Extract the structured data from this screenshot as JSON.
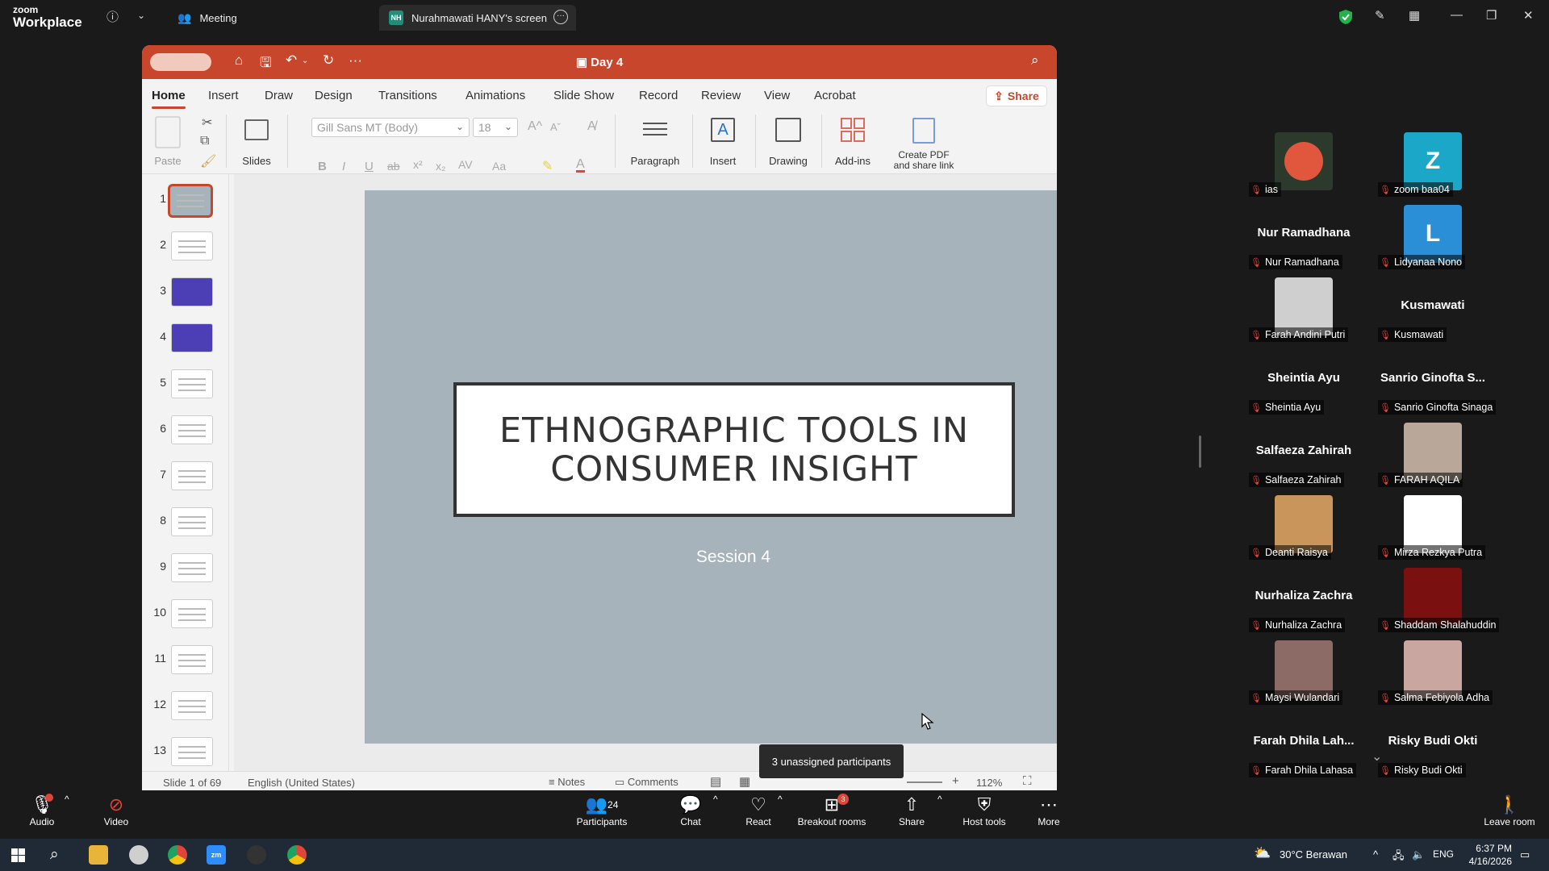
{
  "zoom": {
    "logo_line1": "zoom",
    "logo_line2": "Workplace",
    "meeting_tab": "Meeting",
    "screen_tab": "Nurahmawati HANY's screen",
    "screen_tab_initials": "NH"
  },
  "ppt": {
    "doc_title": "Day 4",
    "tabs": [
      "Home",
      "Insert",
      "Draw",
      "Design",
      "Transitions",
      "Animations",
      "Slide Show",
      "Record",
      "Review",
      "View",
      "Acrobat"
    ],
    "share_label": "Share",
    "ribbon": {
      "paste": "Paste",
      "slides": "Slides",
      "font_name": "Gill Sans MT (Body)",
      "font_size": "18",
      "paragraph": "Paragraph",
      "insert": "Insert",
      "drawing": "Drawing",
      "addins": "Add-ins",
      "create_pdf_1": "Create PDF",
      "create_pdf_2": "and share link"
    },
    "slide_numbers": [
      "1",
      "2",
      "3",
      "4",
      "5",
      "6",
      "7",
      "8",
      "9",
      "10",
      "11",
      "12",
      "13"
    ],
    "slide": {
      "title_line1": "ETHNOGRAPHIC TOOLS IN",
      "title_line2": "CONSUMER INSIGHT",
      "subtitle": "Session 4"
    },
    "status": {
      "slide_of": "Slide 1 of 69",
      "language": "English (United States)",
      "notes": "Notes",
      "comments": "Comments",
      "zoom": "112%"
    }
  },
  "tooltip": "3 unassigned participants",
  "gallery": [
    {
      "name": "",
      "label": "ias",
      "avatar": "crab"
    },
    {
      "name": "",
      "label": "zoom baa04",
      "avatar": "letter",
      "letter": "Z",
      "color": "#1ba7c8"
    },
    {
      "name": "Nur Ramadhana",
      "label": "Nur Ramadhana"
    },
    {
      "name": "",
      "label": "Lidyanaa Nono",
      "avatar": "letter",
      "letter": "L",
      "color": "#2a8fd6"
    },
    {
      "name": "",
      "label": "Farah Andini Putri",
      "avatar": "photo",
      "color": "#cfcfcf"
    },
    {
      "name": "Kusmawati",
      "label": "Kusmawati"
    },
    {
      "name": "Sheintia Ayu",
      "label": "Sheintia Ayu"
    },
    {
      "name": "Sanrio Ginofta S...",
      "label": "Sanrio Ginofta Sinaga"
    },
    {
      "name": "Salfaeza Zahirah",
      "label": "Salfaeza Zahirah"
    },
    {
      "name": "",
      "label": "FARAH AQILA",
      "avatar": "photo",
      "color": "#b9a89a"
    },
    {
      "name": "",
      "label": "Deanti Raisya",
      "avatar": "photo",
      "color": "#c9955a"
    },
    {
      "name": "",
      "label": "Mirza Rezkya Putra",
      "avatar": "photo",
      "color": "#ffffff"
    },
    {
      "name": "Nurhaliza Zachra",
      "label": "Nurhaliza Zachra"
    },
    {
      "name": "",
      "label": "Shaddam Shalahuddin",
      "avatar": "photo",
      "color": "#7a1010"
    },
    {
      "name": "",
      "label": "Maysi Wulandari",
      "avatar": "photo",
      "color": "#8c6b66"
    },
    {
      "name": "",
      "label": "Salma Febiyola Adha",
      "avatar": "photo",
      "color": "#c9a7a0"
    },
    {
      "name": "Farah Dhila Lah...",
      "label": "Farah Dhila Lahasa"
    },
    {
      "name": "Risky Budi Okti",
      "label": "Risky Budi Okti"
    }
  ],
  "toolbar": {
    "audio": "Audio",
    "video": "Video",
    "participants": "Participants",
    "participants_count": "24",
    "chat": "Chat",
    "react": "React",
    "breakout": "Breakout rooms",
    "breakout_badge": "3",
    "share": "Share",
    "host_tools": "Host tools",
    "more": "More",
    "leave": "Leave room"
  },
  "taskbar": {
    "weather": "30°C  Berawan",
    "lang": "ENG",
    "time": "6:37 PM",
    "date": "4/16/2026"
  },
  "colors": {
    "ppt_accent": "#c8462c",
    "slide_bg": "#a6b3bb",
    "zoom_bg": "#1a1a1a"
  }
}
